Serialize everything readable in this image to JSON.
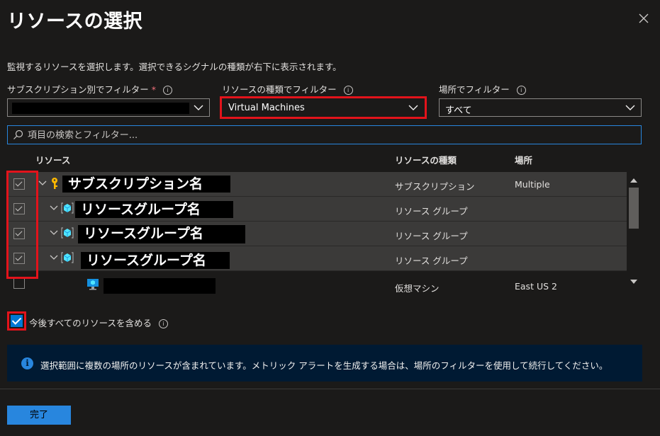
{
  "dialog": {
    "title": "リソースの選択",
    "description": "監視するリソースを選択します。選択できるシグナルの種類が右下に表示されます。"
  },
  "filters": {
    "subscription": {
      "label": "サブスクリプション別でフィルター",
      "required_mark": "*",
      "value": ""
    },
    "resource_type": {
      "label": "リソースの種類でフィルター",
      "value": "Virtual Machines"
    },
    "location": {
      "label": "場所でフィルター",
      "value": "すべて"
    }
  },
  "search": {
    "placeholder": "項目の検索とフィルター..."
  },
  "table": {
    "headers": {
      "resource": "リソース",
      "type": "リソースの種類",
      "location": "場所"
    },
    "rows": [
      {
        "name": "サブスクリプション名",
        "type": "サブスクリプション",
        "location": "Multiple",
        "checked": true,
        "icon": "key-icon"
      },
      {
        "name": "リソースグループ名",
        "type": "リソース グループ",
        "location": "",
        "checked": true,
        "icon": "resource-group-icon"
      },
      {
        "name": "リソースグループ名",
        "type": "リソース グループ",
        "location": "",
        "checked": true,
        "icon": "resource-group-icon"
      },
      {
        "name": "リソースグループ名",
        "type": "リソース グループ",
        "location": "",
        "checked": true,
        "icon": "resource-group-icon"
      },
      {
        "name": "",
        "type": "仮想マシン",
        "location": "East US 2",
        "checked": false,
        "icon": "virtual-machine-icon"
      }
    ]
  },
  "include_future": {
    "label": "今後すべてのリソースを含める",
    "checked": true
  },
  "info_banner": {
    "icon": "i",
    "text": "選択範囲に複数の場所のリソースが含まれています。メトリック アラートを生成する場合は、場所のフィルターを使用して続行してください。"
  },
  "footer": {
    "done_label": "完了"
  },
  "colors": {
    "accent": "#2886de",
    "highlight": "#e3131b",
    "row_bg": "#3b3a39",
    "banner_bg": "#001a33"
  }
}
